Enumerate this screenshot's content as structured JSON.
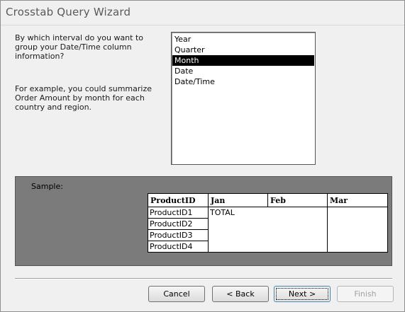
{
  "window": {
    "title": "Crosstab Query Wizard"
  },
  "prompt": {
    "question": "By which interval do you want to\ngroup your Date/Time column\ninformation?",
    "example": "For example, you could summarize\nOrder Amount by month for each\ncountry and region."
  },
  "interval_list": {
    "options": [
      "Year",
      "Quarter",
      "Month",
      "Date",
      "Date/Time"
    ],
    "selected": "Month"
  },
  "sample": {
    "label": "Sample:",
    "columns": [
      "ProductID",
      "Jan",
      "Feb",
      "Mar"
    ],
    "rows": [
      "ProductID1",
      "ProductID2",
      "ProductID3",
      "ProductID4"
    ],
    "total_label": "TOTAL"
  },
  "buttons": {
    "cancel": "Cancel",
    "back": "< Back",
    "next": "Next >",
    "finish": "Finish"
  }
}
